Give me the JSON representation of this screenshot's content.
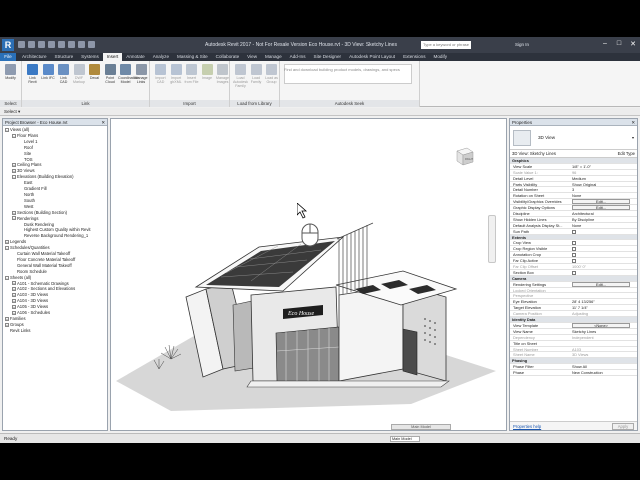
{
  "window": {
    "title": "Autodesk Revit 2017 - Not For Resale Version  Eco House.rvt - 3D View: Sketchy Lines",
    "search_placeholder": "Type a keyword or phrase",
    "signin": "Sign In",
    "controls": [
      "–",
      "□",
      "✕"
    ]
  },
  "ribbon": {
    "file_tab": "File",
    "tabs": [
      "Architecture",
      "Structure",
      "Systems",
      "Insert",
      "Annotate",
      "Analyze",
      "Massing & Site",
      "Collaborate",
      "View",
      "Manage",
      "Add-Ins",
      "Site Designer",
      "Autodesk Point Layout",
      "Extensions",
      "Modify"
    ],
    "active_tab": "Insert",
    "groups": [
      {
        "label": "Select",
        "buttons": [
          {
            "label": "Modify",
            "color": "#8e9bb0",
            "dim": false
          }
        ]
      },
      {
        "label": "Link",
        "buttons": [
          {
            "label": "Link Revit",
            "color": "#3a79c4",
            "dim": false
          },
          {
            "label": "Link IFC",
            "color": "#5a8ac9",
            "dim": false
          },
          {
            "label": "Link CAD",
            "color": "#6a90c2",
            "dim": false
          },
          {
            "label": "DWF Markup",
            "color": "#7f8fa5",
            "dim": true
          },
          {
            "label": "Decal",
            "color": "#b08a3c",
            "dim": false
          },
          {
            "label": "Point Cloud",
            "color": "#6a7f95",
            "dim": false
          },
          {
            "label": "Coordination Model",
            "color": "#6f8aa8",
            "dim": false
          },
          {
            "label": "Manage Links",
            "color": "#8b97a8",
            "dim": false
          }
        ]
      },
      {
        "label": "Import",
        "buttons": [
          {
            "label": "Import CAD",
            "color": "#6d88ad",
            "dim": true
          },
          {
            "label": "Import gbXML",
            "color": "#6d88ad",
            "dim": true
          },
          {
            "label": "Insert from File",
            "color": "#7a8fa8",
            "dim": true
          },
          {
            "label": "Image",
            "color": "#8fa25c",
            "dim": true
          },
          {
            "label": "Manage Images",
            "color": "#7e8c9c",
            "dim": true
          }
        ]
      },
      {
        "label": "Load from Library",
        "buttons": [
          {
            "label": "Load Autodesk Family",
            "color": "#7e8fa6",
            "dim": true
          },
          {
            "label": "Load Family",
            "color": "#7e8fa6",
            "dim": true
          },
          {
            "label": "Load as Group",
            "color": "#7e8fa6",
            "dim": true
          }
        ]
      },
      {
        "label": "Autodesk Seek",
        "seek_text": "Find and download building product models, drawings, and specs"
      }
    ]
  },
  "option_bar": {
    "select_label": "Select ▾"
  },
  "project_browser": {
    "title": "Project Browser - Eco House.rvt",
    "items": [
      {
        "label": "Views (all)",
        "indent": 0,
        "toggle": "−",
        "sel": false
      },
      {
        "label": "Floor Plans",
        "indent": 1,
        "toggle": "−",
        "sel": false
      },
      {
        "label": "Level 1",
        "indent": 2,
        "toggle": "",
        "sel": false
      },
      {
        "label": "Roof",
        "indent": 2,
        "toggle": "",
        "sel": false
      },
      {
        "label": "Site",
        "indent": 2,
        "toggle": "",
        "sel": false
      },
      {
        "label": "TOS",
        "indent": 2,
        "toggle": "",
        "sel": false
      },
      {
        "label": "Ceiling Plans",
        "indent": 1,
        "toggle": "+",
        "sel": false
      },
      {
        "label": "3D Views",
        "indent": 1,
        "toggle": "+",
        "sel": false
      },
      {
        "label": "Elevations (Building Elevation)",
        "indent": 1,
        "toggle": "−",
        "sel": false
      },
      {
        "label": "East",
        "indent": 2,
        "toggle": "",
        "sel": false
      },
      {
        "label": "Gradient Fill",
        "indent": 2,
        "toggle": "",
        "sel": false
      },
      {
        "label": "North",
        "indent": 2,
        "toggle": "",
        "sel": false
      },
      {
        "label": "South",
        "indent": 2,
        "toggle": "",
        "sel": false
      },
      {
        "label": "West",
        "indent": 2,
        "toggle": "",
        "sel": false
      },
      {
        "label": "Sections (Building Section)",
        "indent": 1,
        "toggle": "+",
        "sel": false
      },
      {
        "label": "Renderings",
        "indent": 1,
        "toggle": "−",
        "sel": false
      },
      {
        "label": "Dusk Rendering",
        "indent": 2,
        "toggle": "",
        "sel": false
      },
      {
        "label": "Highest Custom Quality within Revit",
        "indent": 2,
        "toggle": "",
        "sel": false
      },
      {
        "label": "Reverse Background Rendering_1",
        "indent": 2,
        "toggle": "",
        "sel": false
      },
      {
        "label": "Legends",
        "indent": 0,
        "toggle": "+",
        "sel": false
      },
      {
        "label": "Schedules/Quantities",
        "indent": 0,
        "toggle": "−",
        "sel": false
      },
      {
        "label": "Curtain Wall Material Takeoff",
        "indent": 1,
        "toggle": "",
        "sel": false
      },
      {
        "label": "Floor Concrete Material Takeoff",
        "indent": 1,
        "toggle": "",
        "sel": false
      },
      {
        "label": "General Wall Material Takeoff",
        "indent": 1,
        "toggle": "",
        "sel": false
      },
      {
        "label": "Room Schedule",
        "indent": 1,
        "toggle": "",
        "sel": false
      },
      {
        "label": "Sheets (all)",
        "indent": 0,
        "toggle": "−",
        "sel": false
      },
      {
        "label": "A101 - Schematic Drawings",
        "indent": 1,
        "toggle": "+",
        "sel": false
      },
      {
        "label": "A102 - Sections and Elevations",
        "indent": 1,
        "toggle": "+",
        "sel": false
      },
      {
        "label": "A103 - 3D Views",
        "indent": 1,
        "toggle": "+",
        "sel": false
      },
      {
        "label": "A104 - 3D Views",
        "indent": 1,
        "toggle": "+",
        "sel": false
      },
      {
        "label": "A105 - 3D Views",
        "indent": 1,
        "toggle": "+",
        "sel": false
      },
      {
        "label": "A106 - Schedules",
        "indent": 1,
        "toggle": "+",
        "sel": false
      },
      {
        "label": "Families",
        "indent": 0,
        "toggle": "+",
        "sel": false
      },
      {
        "label": "Groups",
        "indent": 0,
        "toggle": "+",
        "sel": false
      },
      {
        "label": "Revit Links",
        "indent": 0,
        "toggle": "",
        "sel": false
      }
    ]
  },
  "viewport": {
    "building_sign": "Eco House",
    "viewcube_label": "RIGHT",
    "model_select": "Main Model"
  },
  "properties": {
    "title": "Properties",
    "type_name": "3D View",
    "view_filter": "3D View: Sketchy Lines",
    "edit_type": "Edit Type",
    "rows": [
      {
        "k": "Graphics",
        "v": "",
        "kind": "grp"
      },
      {
        "k": "View Scale",
        "v": "1/8\" = 1'-0\"",
        "kind": "row"
      },
      {
        "k": "Scale Value 1:",
        "v": "96",
        "kind": "grey"
      },
      {
        "k": "Detail Level",
        "v": "Medium",
        "kind": "row"
      },
      {
        "k": "Parts Visibility",
        "v": "Show Original",
        "kind": "row"
      },
      {
        "k": "Detail Number",
        "v": "3",
        "kind": "row"
      },
      {
        "k": "Rotation on Sheet",
        "v": "None",
        "kind": "row"
      },
      {
        "k": "Visibility/Graphics Overrides",
        "v": "Edit...",
        "kind": "btn"
      },
      {
        "k": "Graphic Display Options",
        "v": "Edit...",
        "kind": "btn"
      },
      {
        "k": "Discipline",
        "v": "Architectural",
        "kind": "row"
      },
      {
        "k": "Show Hidden Lines",
        "v": "By Discipline",
        "kind": "row"
      },
      {
        "k": "Default Analysis Display St...",
        "v": "None",
        "kind": "row"
      },
      {
        "k": "Sun Path",
        "v": "",
        "kind": "chk"
      },
      {
        "k": "Extents",
        "v": "",
        "kind": "grp"
      },
      {
        "k": "Crop View",
        "v": "",
        "kind": "chk"
      },
      {
        "k": "Crop Region Visible",
        "v": "",
        "kind": "chk"
      },
      {
        "k": "Annotation Crop",
        "v": "",
        "kind": "chk"
      },
      {
        "k": "Far Clip Active",
        "v": "",
        "kind": "chk"
      },
      {
        "k": "Far Clip Offset",
        "v": "1000' 0\"",
        "kind": "grey"
      },
      {
        "k": "Section Box",
        "v": "",
        "kind": "chk"
      },
      {
        "k": "Camera",
        "v": "",
        "kind": "grp"
      },
      {
        "k": "Rendering Settings",
        "v": "Edit...",
        "kind": "btn"
      },
      {
        "k": "Locked Orientation",
        "v": "",
        "kind": "grey"
      },
      {
        "k": "Perspective",
        "v": "",
        "kind": "grey"
      },
      {
        "k": "Eye Elevation",
        "v": "28' 4 13/256\"",
        "kind": "row"
      },
      {
        "k": "Target Elevation",
        "v": "11' 7 1/4\"",
        "kind": "row"
      },
      {
        "k": "Camera Position",
        "v": "Adjusting",
        "kind": "grey"
      },
      {
        "k": "Identity Data",
        "v": "",
        "kind": "grp"
      },
      {
        "k": "View Template",
        "v": "<None>",
        "kind": "btn"
      },
      {
        "k": "View Name",
        "v": "Sketchy Lines",
        "kind": "row"
      },
      {
        "k": "Dependency",
        "v": "Independent",
        "kind": "grey"
      },
      {
        "k": "Title on Sheet",
        "v": "",
        "kind": "row"
      },
      {
        "k": "Sheet Number",
        "v": "A103",
        "kind": "grey"
      },
      {
        "k": "Sheet Name",
        "v": "3D Views",
        "kind": "grey"
      },
      {
        "k": "Phasing",
        "v": "",
        "kind": "grp"
      },
      {
        "k": "Phase Filter",
        "v": "Show All",
        "kind": "row"
      },
      {
        "k": "Phase",
        "v": "New Construction",
        "kind": "row"
      }
    ],
    "help_link": "Properties help",
    "apply": "Apply"
  },
  "status": {
    "text": "Ready"
  }
}
